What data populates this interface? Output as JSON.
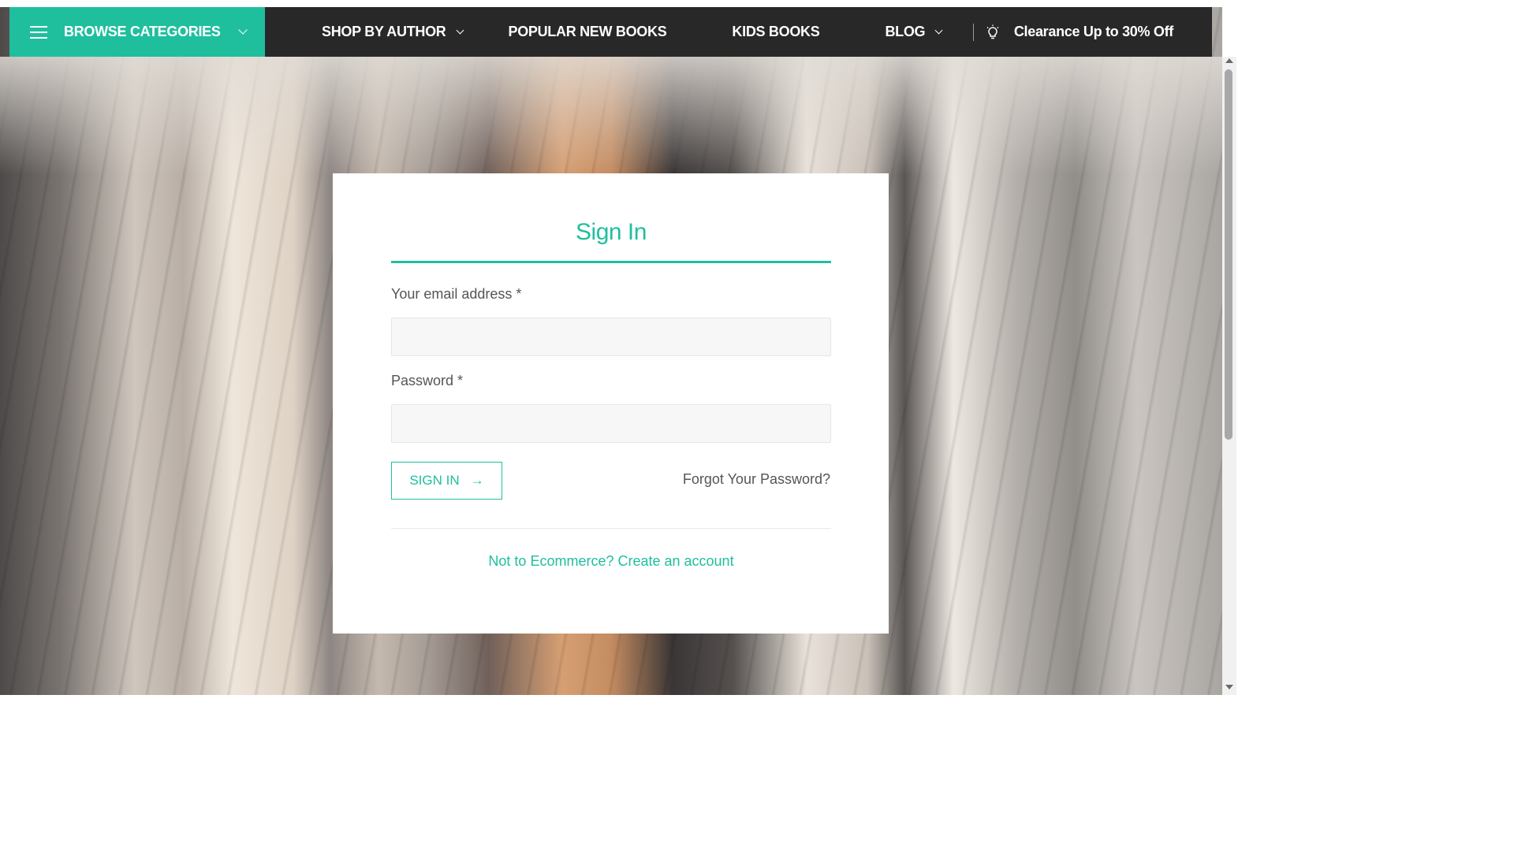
{
  "nav": {
    "browse_label": "BROWSE CATEGORIES",
    "items": [
      {
        "label": "SHOP BY AUTHOR",
        "has_dropdown": true
      },
      {
        "label": "POPULAR NEW BOOKS",
        "has_dropdown": false
      },
      {
        "label": "KIDS BOOKS",
        "has_dropdown": false
      },
      {
        "label": "BLOG",
        "has_dropdown": true
      }
    ],
    "promo_icon": "lightbulb-icon",
    "promo_text": "Clearance Up to 30% Off"
  },
  "signin": {
    "title": "Sign In",
    "email_label": "Your email address *",
    "email_value": "",
    "password_label": "Password *",
    "password_value": "",
    "submit_label": "SIGN IN",
    "submit_icon": "arrow-right-icon",
    "forgot_link": "Forgot Your Password?",
    "create_account_link": "Not to Ecommerce? Create an account"
  },
  "colors": {
    "accent": "#1fbf9e",
    "nav_bg": "#282828"
  }
}
